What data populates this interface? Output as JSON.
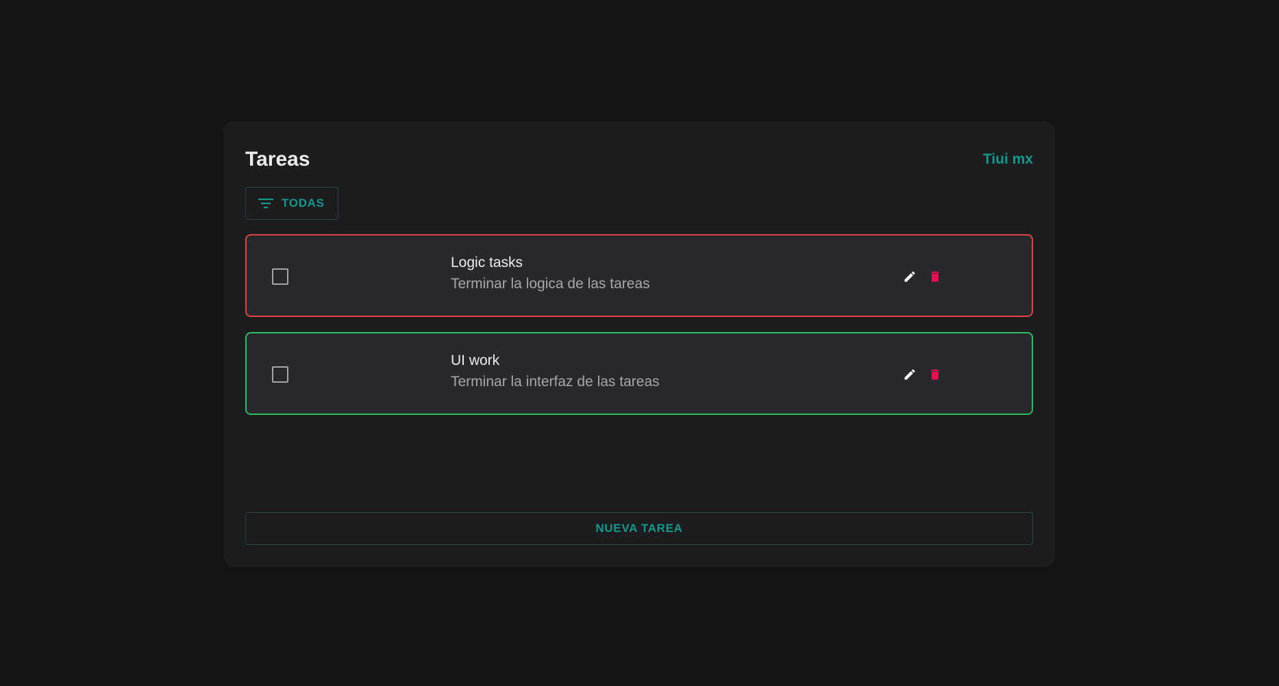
{
  "header": {
    "title": "Tareas",
    "brand": "Tiui mx"
  },
  "filter": {
    "label": "TODAS",
    "icon": "filter-list-icon"
  },
  "tasks": [
    {
      "title": "Logic tasks",
      "description": "Terminar la logica de las tareas",
      "checked": false,
      "border_color": "#e0443e"
    },
    {
      "title": "UI work",
      "description": "Terminar la interfaz de las tareas",
      "checked": false,
      "border_color": "#2bbf62"
    }
  ],
  "icons": {
    "edit": "pencil-icon",
    "delete": "trash-icon"
  },
  "new_task_button": {
    "label": "NUEVA TAREA"
  },
  "colors": {
    "background": "#141316",
    "card": "#1d1c1f",
    "accent": "#139a8c",
    "delete": "#e8104f",
    "task_bg": "#29282c"
  }
}
